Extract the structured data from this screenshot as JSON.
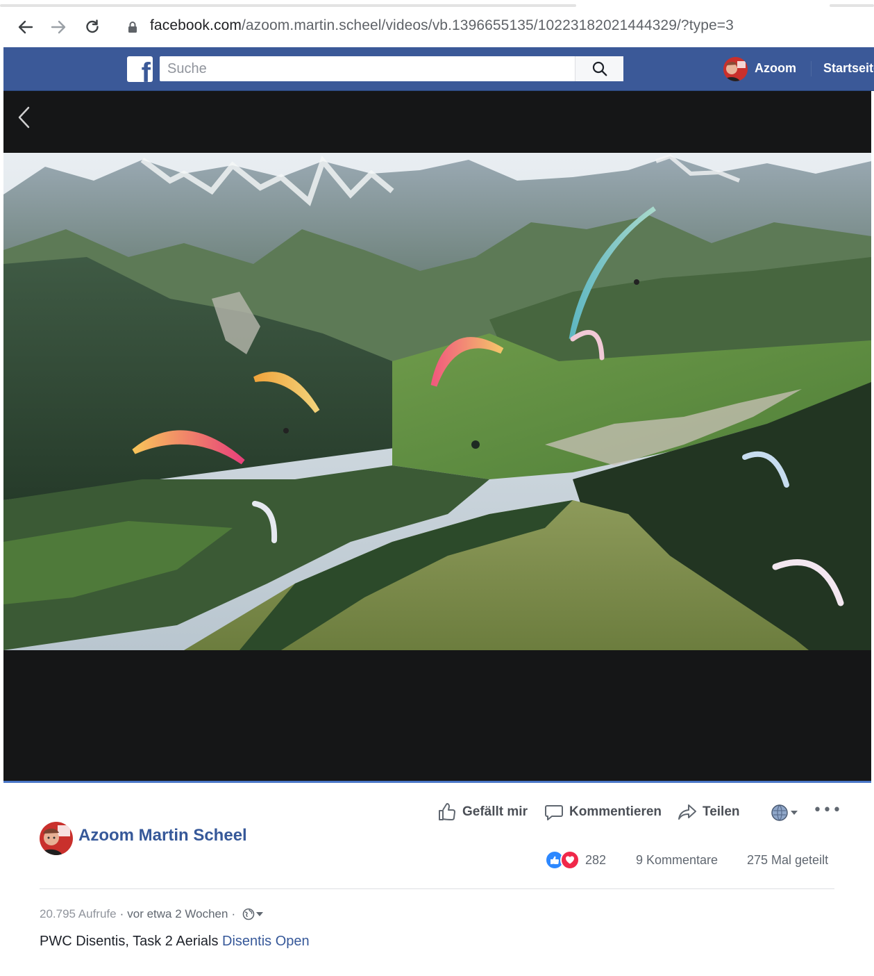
{
  "browser": {
    "url_domain": "facebook.com",
    "url_path": "/azoom.martin.scheel/videos/vb.1396655135/10223182021444329/?type=3"
  },
  "header": {
    "logo_letter": "f",
    "search_placeholder": "Suche",
    "user_name": "Azoom",
    "home_label": "Startseite"
  },
  "actions": {
    "like_label": "Gefällt mir",
    "comment_label": "Kommentieren",
    "share_label": "Teilen"
  },
  "post": {
    "author_name": "Azoom Martin Scheel",
    "reaction_count": "282",
    "comments_count": "9 Kommentare",
    "shares_count": "275 Mal geteilt",
    "views": "20.795 Aufrufe",
    "time": "vor etwa 2 Wochen",
    "caption_text": "PWC Disentis, Task 2 Aerials ",
    "caption_link": "Disentis Open"
  },
  "colors": {
    "facebook_blue": "#3b5998",
    "link_blue": "#365899",
    "like_blue": "#2d88ff",
    "love_red": "#f0284a",
    "video_bg": "#151617"
  }
}
